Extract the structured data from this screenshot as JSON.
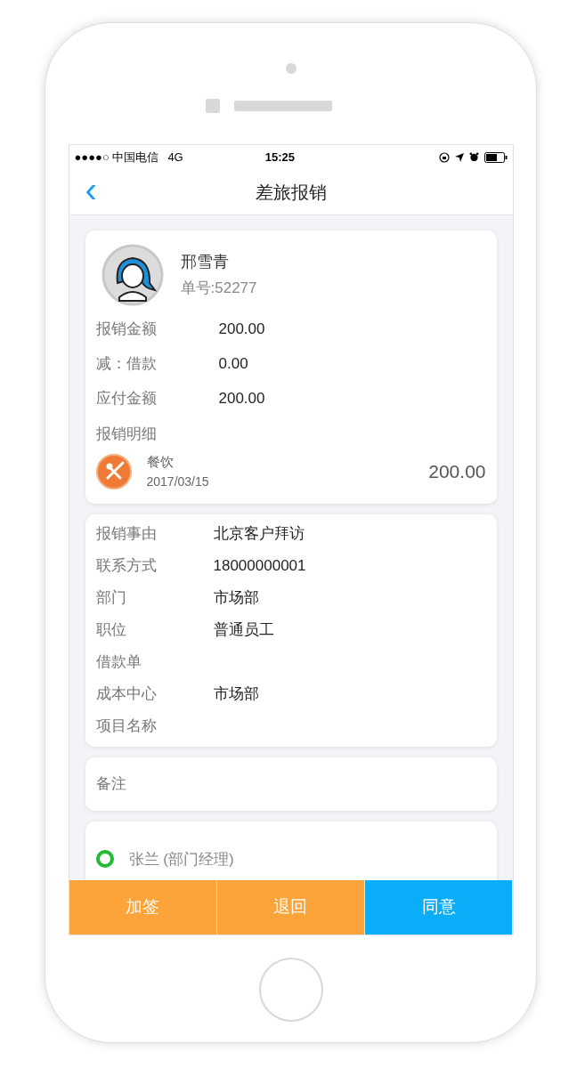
{
  "status_bar": {
    "carrier": "●●●●○ 中国电信",
    "network": "4G",
    "time": "15:25"
  },
  "nav": {
    "back": "‹",
    "title": "差旅报销"
  },
  "applicant": {
    "name": "邢雪青",
    "number": "单号:52277"
  },
  "amounts": [
    {
      "label": "报销金额",
      "value": "200.00"
    },
    {
      "label": "减：借款",
      "value": "0.00"
    },
    {
      "label": "应付金额",
      "value": "200.00"
    }
  ],
  "details_label": "报销明细",
  "expense_items": [
    {
      "category": "餐饮",
      "date": "2017/03/15",
      "amount": "200.00"
    }
  ],
  "info": [
    {
      "label": "报销事由",
      "value": "北京客户拜访"
    },
    {
      "label": "联系方式",
      "value": "18000000001"
    },
    {
      "label": "部门",
      "value": "市场部"
    },
    {
      "label": "职位",
      "value": "普通员工"
    },
    {
      "label": "借款单"
    },
    {
      "label": "成本中心",
      "value": "市场部"
    },
    {
      "label": "项目名称"
    }
  ],
  "remark_label": "备注",
  "approvers": [
    {
      "name": "张兰 (部门经理)",
      "color": "#22bb33"
    }
  ],
  "actions": [
    {
      "label": "加签",
      "kind": "secondary"
    },
    {
      "label": "退回",
      "kind": "secondary"
    },
    {
      "label": "同意",
      "kind": "primary"
    }
  ]
}
